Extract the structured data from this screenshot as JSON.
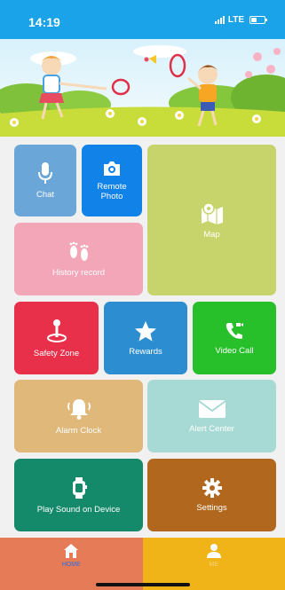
{
  "status_bar": {
    "time": "14:19",
    "network": "LTE",
    "icons": [
      "signal-icon",
      "battery-icon"
    ]
  },
  "banner": {
    "description_icons": [
      "girl-badminton-illustration",
      "boy-badminton-illustration"
    ]
  },
  "tiles": {
    "chat": {
      "label": "Chat",
      "icon": "microphone-icon"
    },
    "remote_photo": {
      "label": "Remote Photo",
      "icon": "camera-icon"
    },
    "map": {
      "label": "Map",
      "icon": "map-icon"
    },
    "history": {
      "label": "History record",
      "icon": "footprints-icon"
    },
    "safety_zone": {
      "label": "Safety Zone",
      "icon": "location-pin-icon"
    },
    "rewards": {
      "label": "Rewards",
      "icon": "star-icon"
    },
    "video_call": {
      "label": "Video Call",
      "icon": "video-call-icon"
    },
    "alarm_clock": {
      "label": "Alarm Clock",
      "icon": "bell-icon"
    },
    "alert_center": {
      "label": "Alert Center",
      "icon": "envelope-icon"
    },
    "play_sound": {
      "label": "Play Sound on Device",
      "icon": "smartwatch-icon"
    },
    "settings": {
      "label": "Settings",
      "icon": "gear-icon"
    }
  },
  "tabbar": {
    "home": {
      "label": "HOME",
      "icon": "home-icon"
    },
    "me": {
      "label": "ME",
      "icon": "person-icon"
    }
  },
  "colors": {
    "status_bar": "#1aa3e8",
    "chat": "#6aa7d8",
    "remote_photo": "#1082e8",
    "map": "#c7d46b",
    "history": "#f3a6b8",
    "safety_zone": "#e8304b",
    "rewards": "#2c8ed0",
    "video_call": "#28c02a",
    "alarm_clock": "#e0b879",
    "alert_center": "#a8dad5",
    "play_sound": "#148a6a",
    "settings": "#b1671d",
    "tab_home": "#e67b57",
    "tab_me": "#f0b419"
  }
}
